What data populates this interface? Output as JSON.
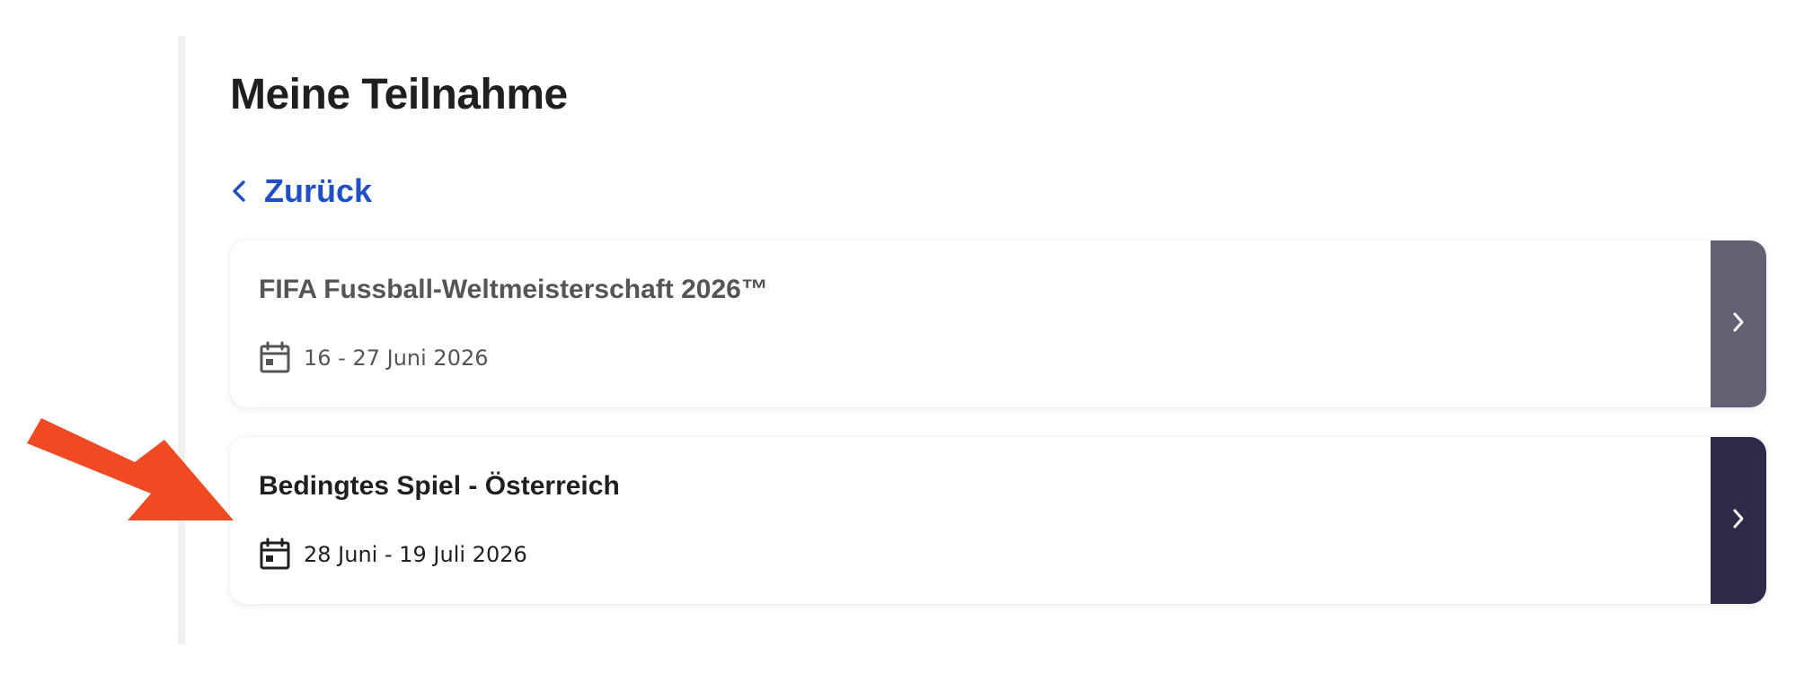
{
  "header": {
    "title": "Meine Teilnahme"
  },
  "navigation": {
    "back_label": "Zurück",
    "back_icon": "chevron-left-icon"
  },
  "events": [
    {
      "title": "FIFA Fussball-Weltmeisterschaft 2026™",
      "date": "16 - 27 Juni 2026",
      "date_icon": "calendar-icon",
      "action_icon": "chevron-right-icon",
      "action_color": "#646074"
    },
    {
      "title": "Bedingtes Spiel - Österreich",
      "date": "28 Juni - 19 Juli 2026",
      "date_icon": "calendar-icon",
      "action_icon": "chevron-right-icon",
      "action_color": "#2f2a47"
    }
  ],
  "annotation": {
    "type": "arrow",
    "color": "#f04a23",
    "points_to": "events.1"
  },
  "colors": {
    "link": "#1f4fc3",
    "text_dark": "#1f1f1f",
    "text_muted": "#555555"
  }
}
